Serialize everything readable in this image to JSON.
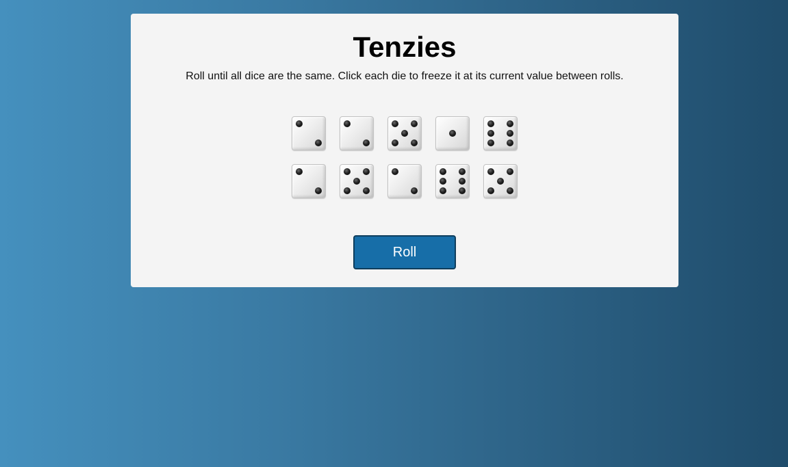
{
  "game": {
    "title": "Tenzies",
    "instructions": "Roll until all dice are the same. Click each die to freeze it at its current value between rolls.",
    "dice": [
      {
        "value": 2,
        "frozen": false
      },
      {
        "value": 2,
        "frozen": false
      },
      {
        "value": 5,
        "frozen": false
      },
      {
        "value": 1,
        "frozen": false
      },
      {
        "value": 6,
        "frozen": false
      },
      {
        "value": 2,
        "frozen": false
      },
      {
        "value": 5,
        "frozen": false
      },
      {
        "value": 2,
        "frozen": false
      },
      {
        "value": 6,
        "frozen": false
      },
      {
        "value": 5,
        "frozen": false
      }
    ],
    "roll_label": "Roll"
  },
  "colors": {
    "panel": "#f4f4f4",
    "button": "#176ea8",
    "button_border": "#0e3d5c",
    "pip": "#000000"
  }
}
